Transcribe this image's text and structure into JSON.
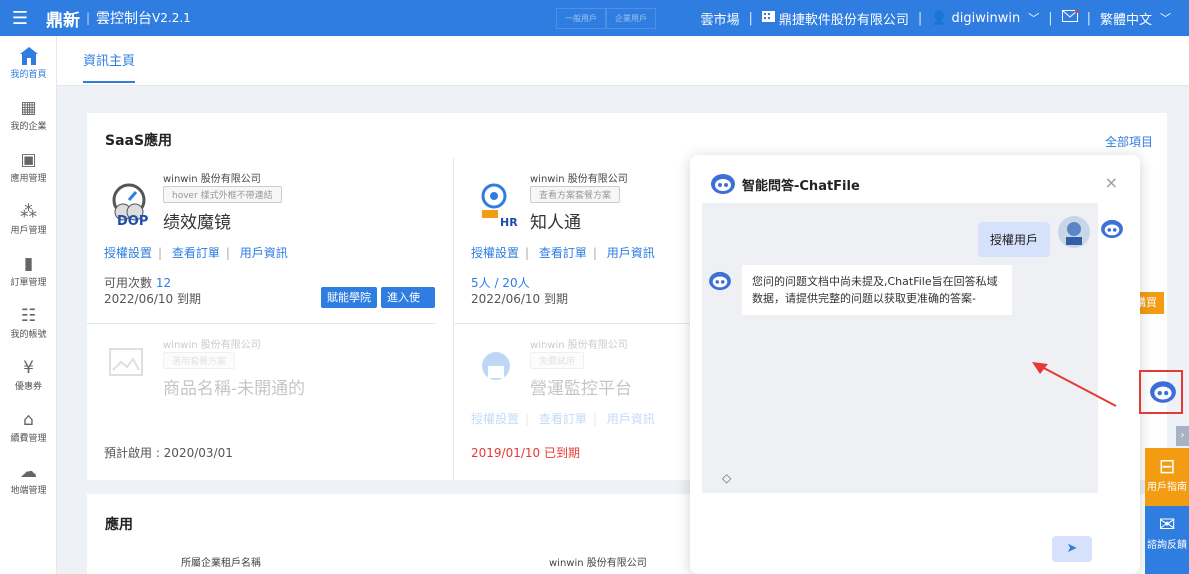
{
  "topbar": {
    "menu_icon": "menu-icon",
    "brand_logo": "鼎新",
    "brand_name": "雲控制台",
    "version": "V2.2.1",
    "center_tabs": [
      "一般用戶",
      "企業用戶"
    ],
    "marketplace": "雲市場",
    "company_icon": "building-icon",
    "company": "鼎捷軟件股份有限公司",
    "user_icon": "user-icon",
    "username": "digiwinwin",
    "mail_icon": "mail-icon",
    "language": "繁體中文"
  },
  "sidebar": {
    "items": [
      {
        "label": "我的首頁",
        "icon": "home-icon"
      },
      {
        "label": "我的企業",
        "icon": "building-icon"
      },
      {
        "label": "應用管理",
        "icon": "grid-icon"
      },
      {
        "label": "用戶管理",
        "icon": "users-icon"
      },
      {
        "label": "訂單管理",
        "icon": "order-icon"
      },
      {
        "label": "我的帳號",
        "icon": "sliders-icon"
      },
      {
        "label": "優惠券",
        "icon": "coupon-icon"
      },
      {
        "label": "續費管理",
        "icon": "renew-icon"
      },
      {
        "label": "地端管理",
        "icon": "cloud-icon"
      }
    ]
  },
  "tabs": {
    "active": "資訊主頁"
  },
  "saas": {
    "title": "SaaS應用",
    "all_link": "全部項目",
    "cards": [
      {
        "company": "winwin 股份有限公司",
        "tag": "hover 樣式外框不帶連結",
        "name": "绩效魔镜",
        "icon_label": "DOP",
        "links": [
          "授權設置",
          "查看訂單",
          "用戶資訊"
        ],
        "line1_prefix": "可用次數",
        "line1_value": "12",
        "line2": "2022/06/10 到期",
        "buttons": [
          "賦能學院",
          "進入使用"
        ]
      },
      {
        "company": "winwin 股份有限公司",
        "tag": "查看方案套餐方案",
        "name": "知人通",
        "icon_label": "HR",
        "links": [
          "授權設置",
          "查看訂單",
          "用戶資訊"
        ],
        "line1_value": "5人 / 20人",
        "line2": "2022/06/10 到期"
      },
      {
        "company": "winwin 股份有限公司",
        "tag": "選用套餐方案",
        "name": "商品名稱-未開通的",
        "line2": "預計啟用 : 2020/03/01"
      },
      {
        "company": "winwin 股份有限公司",
        "tag": "免費試用",
        "name": "營運監控平台",
        "links": [
          "授權設置",
          "查看訂單",
          "用戶資訊"
        ],
        "line2": "2019/01/10 已到期"
      }
    ],
    "buy_label": "購買"
  },
  "apps": {
    "title": "應用",
    "card1_company": "所屬企業租戶名稱",
    "card2_company": "winwin 股份有限公司"
  },
  "chat": {
    "title": "智能問答-ChatFile",
    "user_message": "授權用戶",
    "bot_message": "您问的问题文档中尚未提及,ChatFile旨在回答私域数据，请提供完整的问题以获取更准确的答案-"
  },
  "float": {
    "guide_label": "用戶指南",
    "feedback_label": "諮詢反饋"
  },
  "colors": {
    "primary": "#2f7de0",
    "orange": "#f39c12",
    "red": "#e53935"
  }
}
